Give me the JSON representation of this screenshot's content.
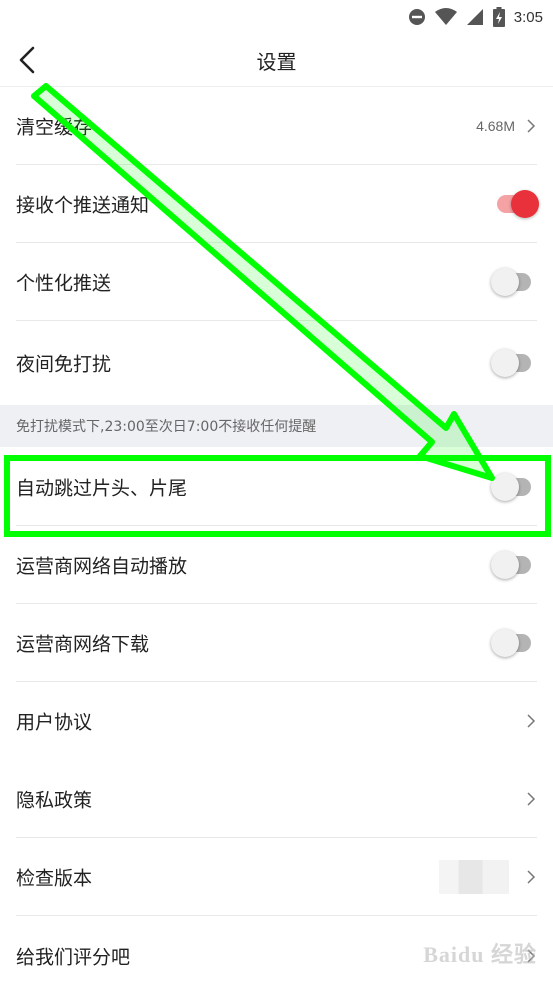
{
  "status_bar": {
    "time": "3:05",
    "icons": [
      "do-not-disturb-icon",
      "wifi-icon",
      "signal-icon",
      "battery-charging-icon"
    ]
  },
  "header": {
    "title": "设置",
    "back_icon": "back-arrow-icon"
  },
  "settings": {
    "clear_cache": {
      "label": "清空缓存",
      "value": "4.68M"
    },
    "push_notifications": {
      "label": "接收个推送通知",
      "enabled": true
    },
    "personalized_push": {
      "label": "个性化推送",
      "enabled": false
    },
    "do_not_disturb": {
      "label": "夜间免打扰",
      "enabled": false
    },
    "dnd_notice": "免打扰模式下,23:00至次日7:00不接收任何提醒",
    "auto_skip": {
      "label": "自动跳过片头、片尾",
      "enabled": false
    },
    "carrier_autoplay": {
      "label": "运营商网络自动播放",
      "enabled": false
    },
    "carrier_download": {
      "label": "运营商网络下载",
      "enabled": false
    },
    "user_agreement": {
      "label": "用户协议"
    },
    "privacy_policy": {
      "label": "隐私政策"
    },
    "check_version": {
      "label": "检查版本"
    },
    "rate_us": {
      "label": "给我们评分吧"
    }
  },
  "colors": {
    "toggle_on": "#e8313a",
    "toggle_on_track": "#f5a2a5",
    "toggle_off_track": "#b4b4b4",
    "annotation": "#00ff00"
  },
  "watermark": "Baidu 经验"
}
